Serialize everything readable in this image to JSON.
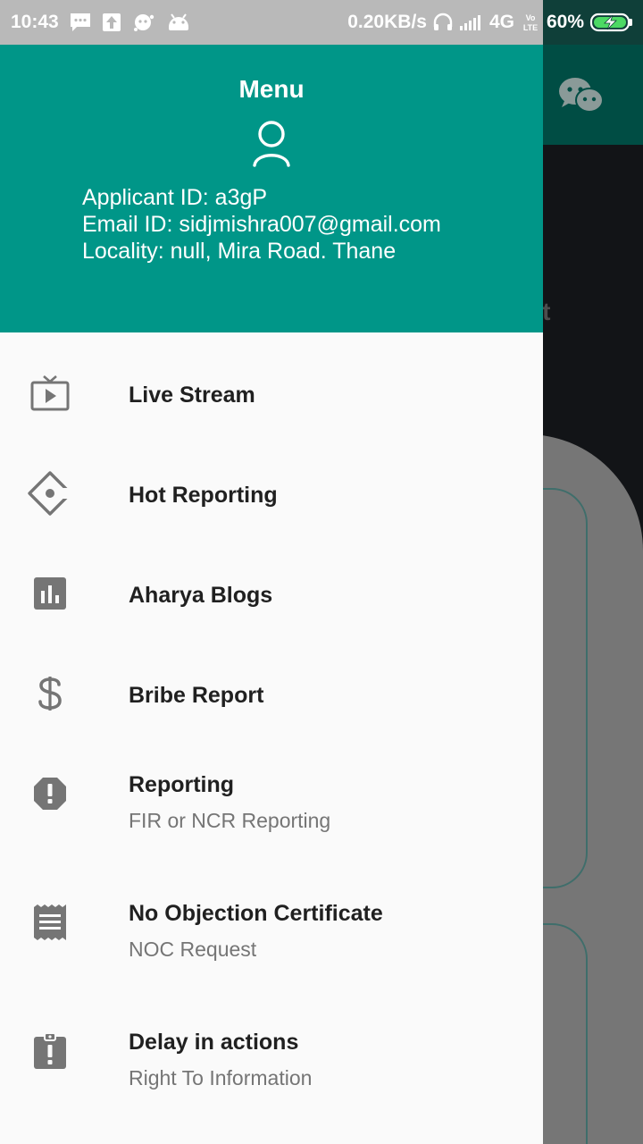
{
  "status_bar": {
    "time": "10:43",
    "network_speed": "0.20KB/s",
    "network_type": "4G",
    "volte": "Vo LTE",
    "battery": "60%"
  },
  "background_app": {
    "partial_text": "nt"
  },
  "drawer": {
    "title": "Menu",
    "applicant_id": "Applicant ID: a3gP",
    "email_id": "Email ID: sidjmishra007@gmail.com",
    "locality": "Locality: null, Mira Road. Thane",
    "items": [
      {
        "label": "Live Stream",
        "sub": "",
        "icon": "tv-play-icon"
      },
      {
        "label": "Hot Reporting",
        "sub": "",
        "icon": "diamond-target-icon"
      },
      {
        "label": "Aharya Blogs",
        "sub": "",
        "icon": "bar-chart-icon"
      },
      {
        "label": "Bribe Report",
        "sub": "",
        "icon": "dollar-icon"
      },
      {
        "label": "Reporting",
        "sub": "FIR or NCR Reporting",
        "icon": "alert-octagon-icon"
      },
      {
        "label": "No Objection Certificate",
        "sub": "NOC Request",
        "icon": "receipt-icon"
      },
      {
        "label": "Delay in actions",
        "sub": "Right To Information",
        "icon": "clipboard-alert-icon"
      }
    ]
  },
  "colors": {
    "header": "#009688",
    "icon": "#757575",
    "text": "#202020",
    "subtext": "#757575"
  }
}
